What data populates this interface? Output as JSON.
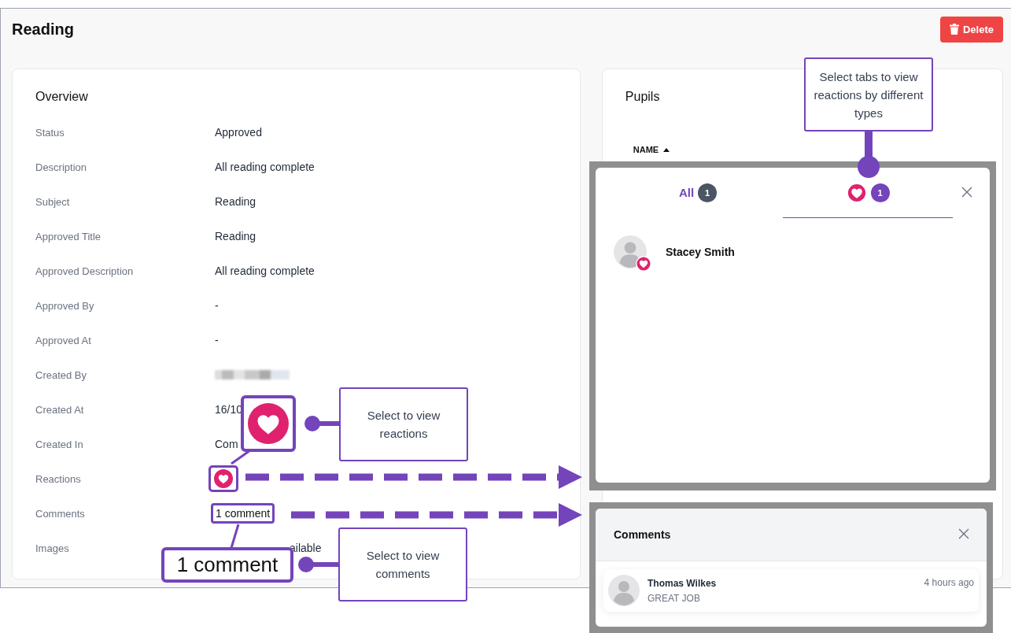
{
  "page": {
    "title": "Reading",
    "delete_button": "Delete"
  },
  "overview": {
    "title": "Overview",
    "rows": [
      {
        "label": "Status",
        "kind": "text",
        "value": "Approved"
      },
      {
        "label": "Description",
        "kind": "text",
        "value": "All reading complete"
      },
      {
        "label": "Subject",
        "kind": "text",
        "value": "Reading"
      },
      {
        "label": "Approved Title",
        "kind": "text",
        "value": "Reading"
      },
      {
        "label": "Approved Description",
        "kind": "text",
        "value": "All reading complete"
      },
      {
        "label": "Approved By",
        "kind": "text",
        "value": "-"
      },
      {
        "label": "Approved At",
        "kind": "text",
        "value": "-"
      },
      {
        "label": "Created By",
        "kind": "redacted"
      },
      {
        "label": "Created At",
        "kind": "text",
        "value": "16/10"
      },
      {
        "label": "Created In",
        "kind": "text",
        "value": "Com"
      },
      {
        "label": "Reactions",
        "kind": "reaction"
      },
      {
        "label": "Comments",
        "kind": "link",
        "value": "1 comment"
      },
      {
        "label": "Images",
        "kind": "partial",
        "value": "ailable"
      }
    ]
  },
  "pupils": {
    "title": "Pupils",
    "columns": [
      {
        "label": "NAME",
        "sorted": true
      }
    ]
  },
  "reactions_modal": {
    "tabs": [
      {
        "kind": "all",
        "label": "All",
        "count": "1",
        "selected": false
      },
      {
        "kind": "heart",
        "count": "1",
        "selected": true
      }
    ],
    "people": [
      {
        "name": "Stacey Smith"
      }
    ]
  },
  "comments_modal": {
    "title": "Comments",
    "comments": [
      {
        "author": "Thomas Wilkes",
        "text": "GREAT JOB",
        "time": "4 hours ago"
      }
    ]
  },
  "annotations": [
    {
      "kind": "tabs",
      "text": "Select tabs to view reactions by different types"
    },
    {
      "kind": "reactions",
      "text": "Select to view reactions"
    },
    {
      "kind": "comments",
      "text": "Select to view comments",
      "zoom_text": "1 comment"
    }
  ]
}
